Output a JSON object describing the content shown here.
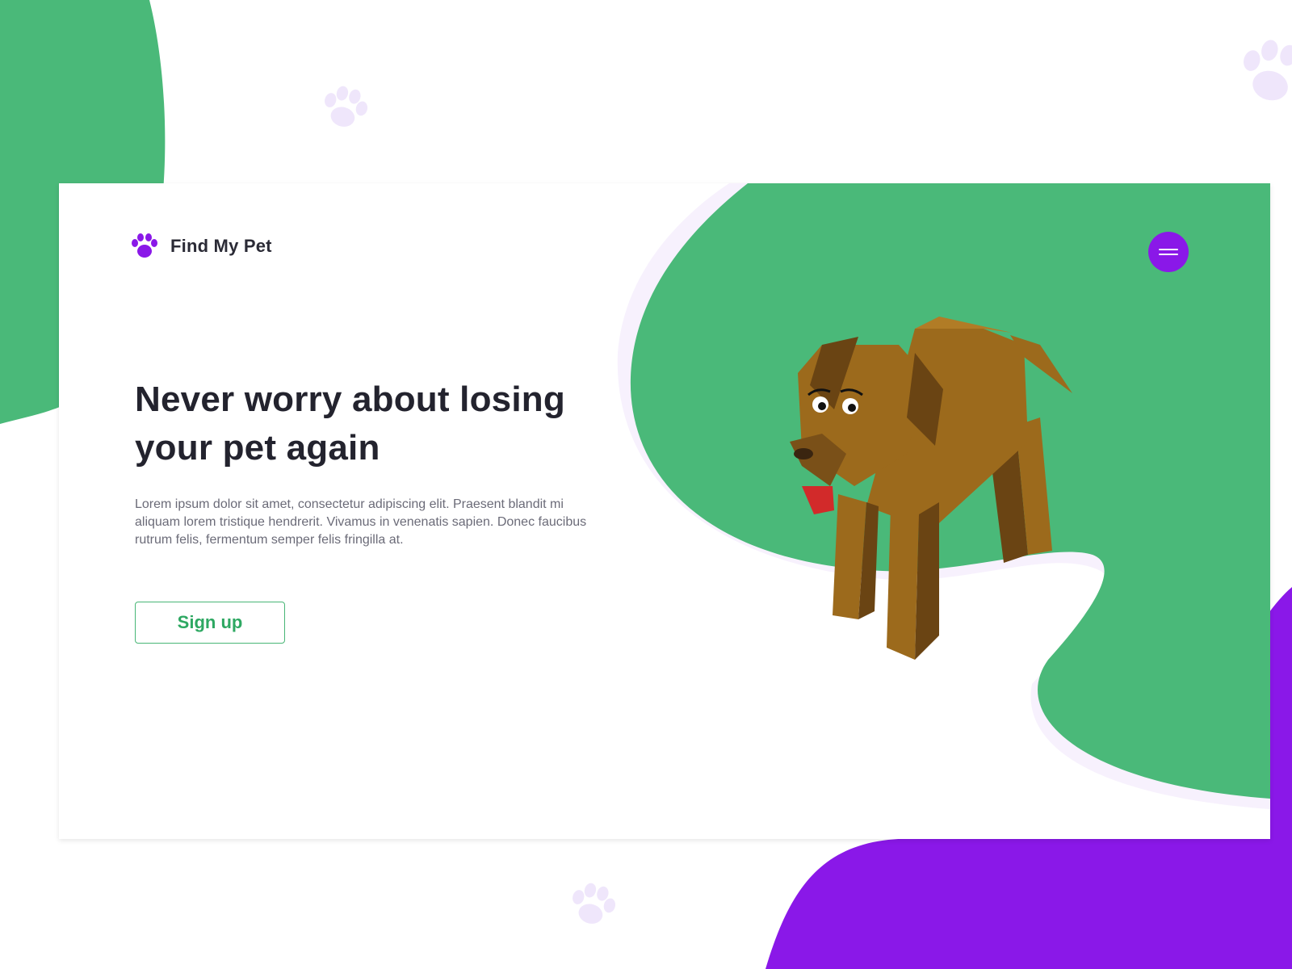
{
  "brand": {
    "name": "Find My Pet",
    "icon": "paw-icon"
  },
  "nav": {
    "menu_icon": "hamburger-menu-icon"
  },
  "hero": {
    "title": "Never worry about losing your pet again",
    "body": "Lorem ipsum dolor sit amet, consectetur adipiscing elit. Praesent blandit mi aliquam lorem tristique hendrerit. Vivamus in venenatis sapien. Donec faucibus rutrum felis, fermentum semper felis fringilla at.",
    "cta_label": "Sign up"
  },
  "illustration": {
    "subject": "dog-illustration"
  },
  "colors": {
    "brand_green": "#4ab979",
    "brand_purple": "#8a18e8",
    "heading": "#23232e",
    "body_text": "#6b6b78",
    "paw_deco": "#efe6fb",
    "dog_brown": "#9c6a1c"
  }
}
